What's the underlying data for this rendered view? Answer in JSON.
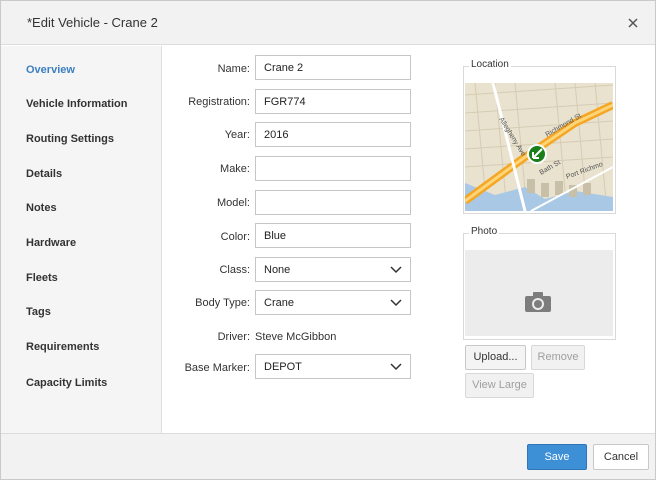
{
  "dialog": {
    "title": "*Edit Vehicle - Crane 2",
    "close_icon": "close-icon"
  },
  "sidebar": {
    "items": [
      {
        "label": "Overview",
        "active": true
      },
      {
        "label": "Vehicle Information",
        "active": false
      },
      {
        "label": "Routing Settings",
        "active": false
      },
      {
        "label": "Details",
        "active": false
      },
      {
        "label": "Notes",
        "active": false
      },
      {
        "label": "Hardware",
        "active": false
      },
      {
        "label": "Fleets",
        "active": false
      },
      {
        "label": "Tags",
        "active": false
      },
      {
        "label": "Requirements",
        "active": false
      },
      {
        "label": "Capacity Limits",
        "active": false
      }
    ],
    "active_color": "#3c7fc1"
  },
  "form": {
    "name": {
      "label": "Name:",
      "value": "Crane 2"
    },
    "registration": {
      "label": "Registration:",
      "value": "FGR774"
    },
    "year": {
      "label": "Year:",
      "value": "2016"
    },
    "make": {
      "label": "Make:",
      "value": ""
    },
    "model": {
      "label": "Model:",
      "value": ""
    },
    "color": {
      "label": "Color:",
      "value": "Blue"
    },
    "class": {
      "label": "Class:",
      "value": "None"
    },
    "body_type": {
      "label": "Body Type:",
      "value": "Crane"
    },
    "driver": {
      "label": "Driver:",
      "value": "Steve McGibbon"
    },
    "base_marker": {
      "label": "Base Marker:",
      "value": "DEPOT"
    }
  },
  "location": {
    "title": "Location",
    "map_labels": [
      "Allegheny Ave",
      "Richmond St",
      "Bath St",
      "Port Richmo"
    ],
    "marker_icon": "vehicle-marker-icon"
  },
  "photo": {
    "title": "Photo",
    "camera_icon": "camera-icon",
    "upload_label": "Upload...",
    "remove_label": "Remove",
    "view_large_label": "View Large"
  },
  "footer": {
    "save_label": "Save",
    "cancel_label": "Cancel",
    "save_color": "#3d8fd6"
  }
}
